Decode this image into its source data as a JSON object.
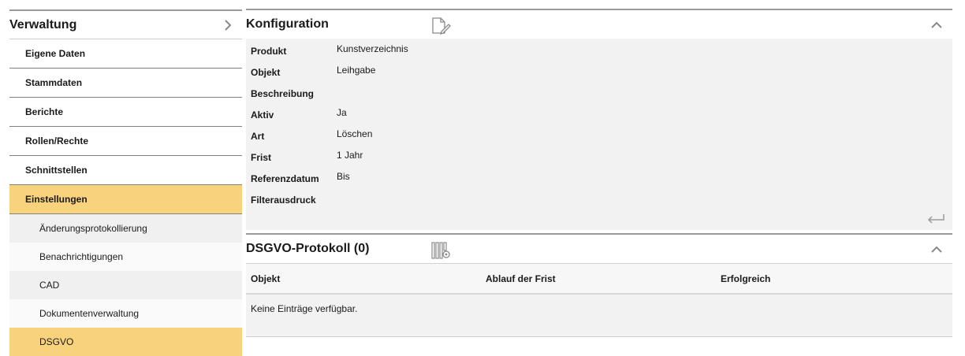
{
  "sidebar": {
    "title": "Verwaltung",
    "expand_icon": "chevron-right-icon",
    "items": [
      {
        "label": "Eigene Daten"
      },
      {
        "label": "Stammdaten"
      },
      {
        "label": "Berichte"
      },
      {
        "label": "Rollen/Rechte"
      },
      {
        "label": "Schnittstellen"
      },
      {
        "label": "Einstellungen",
        "active": true
      }
    ],
    "subitems": [
      {
        "label": "Änderungsprotokollierung"
      },
      {
        "label": "Benachrichtigungen"
      },
      {
        "label": "CAD"
      },
      {
        "label": "Dokumentenverwaltung"
      },
      {
        "label": "DSGVO",
        "active": true
      }
    ]
  },
  "konfiguration": {
    "title": "Konfiguration",
    "edit_icon": "edit-document-icon",
    "collapse_icon": "chevron-up-icon",
    "back_icon": "return-arrow-icon",
    "fields": [
      {
        "label": "Produkt",
        "value": "Kunstverzeichnis"
      },
      {
        "label": "Objekt",
        "value": "Leihgabe"
      },
      {
        "label": "Beschreibung",
        "value": ""
      },
      {
        "label": "Aktiv",
        "value": "Ja"
      },
      {
        "label": "Art",
        "value": "Löschen"
      },
      {
        "label": "Frist",
        "value": "1 Jahr"
      },
      {
        "label": "Referenzdatum",
        "value": "Bis"
      },
      {
        "label": "Filterausdruck",
        "value": ""
      }
    ]
  },
  "protokoll": {
    "title": "DSGVO-Protokoll (0)",
    "settings_icon": "column-settings-icon",
    "collapse_icon": "chevron-up-icon",
    "columns": [
      "Objekt",
      "Ablauf der Frist",
      "Erfolgreich"
    ],
    "empty_text": "Keine Einträge verfügbar."
  },
  "colors": {
    "active_bg": "#f9d27c",
    "panel_bg": "#f2f2f2"
  }
}
